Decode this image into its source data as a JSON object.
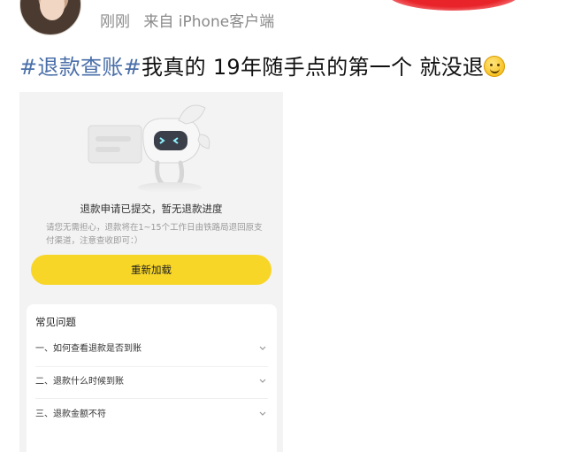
{
  "post": {
    "username": "刚刚",
    "source": "来自 iPhone客户端",
    "hashtag": "#退款查账#",
    "text": "我真的 19年随手点的第一个 就没退"
  },
  "refund_page": {
    "status_title": "退款申请已提交，暂无退款进度",
    "status_desc": "请您无需担心，退款将在1~15个工作日由铁路局退回原支付渠道，注意查收即可：）",
    "reload_label": "重新加载",
    "faq_title": "常见问题",
    "faq_items": [
      {
        "label": "一、如何查看退款是否到账"
      },
      {
        "label": "二、退款什么时候到账"
      },
      {
        "label": "三、退款金额不符"
      }
    ]
  },
  "colors": {
    "accent_yellow": "#f7d628",
    "hashtag_blue": "#4a6fa8",
    "badge_red": "#e8242a"
  },
  "icons": [
    "avatar",
    "smile-emoji-icon",
    "robot-mascot-illustration",
    "chevron-down-icon"
  ]
}
